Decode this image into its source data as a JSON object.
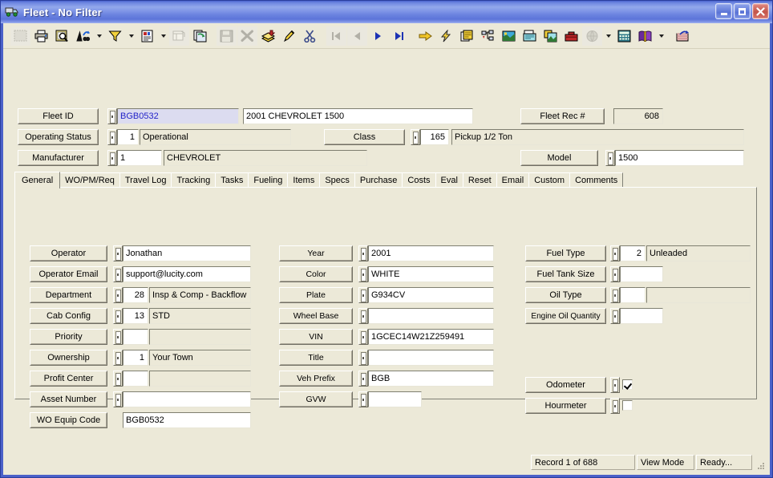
{
  "window": {
    "title": "Fleet - No Filter",
    "icon": "truck-icon",
    "minimize_label": "Minimize",
    "maximize_label": "Maximize",
    "close_label": "Close"
  },
  "toolbar": {
    "groups": [
      {
        "buttons": [
          {
            "name": "new-record-icon",
            "label": "New",
            "disabled": true
          },
          {
            "name": "print-icon",
            "label": "Print"
          },
          {
            "name": "print-preview-icon",
            "label": "Print Preview"
          },
          {
            "name": "find-icon",
            "label": "Find"
          },
          {
            "name": "dropdown-arrow",
            "label": "",
            "dropdown": true
          },
          {
            "name": "filter-icon",
            "label": "Filter"
          },
          {
            "name": "dropdown-arrow",
            "label": "",
            "dropdown": true
          },
          {
            "name": "report-icon",
            "label": "Report"
          },
          {
            "name": "dropdown-arrow",
            "label": "",
            "dropdown": true
          },
          {
            "name": "grid-view-icon",
            "label": "Grid View",
            "disabled": true
          },
          {
            "name": "copy-record-icon",
            "label": "Copy Record"
          }
        ]
      },
      {
        "buttons": [
          {
            "name": "save-icon",
            "label": "Save",
            "disabled": true
          },
          {
            "name": "delete-icon",
            "label": "Delete",
            "disabled": true
          },
          {
            "name": "add-record-icon",
            "label": "Add Record"
          },
          {
            "name": "edit-icon",
            "label": "Edit"
          },
          {
            "name": "cut-icon",
            "label": "Cut"
          }
        ]
      },
      {
        "buttons": [
          {
            "name": "first-record-icon",
            "label": "First Record",
            "disabled": true
          },
          {
            "name": "previous-record-icon",
            "label": "Previous Record",
            "disabled": true
          },
          {
            "name": "next-record-icon",
            "label": "Next Record"
          },
          {
            "name": "last-record-icon",
            "label": "Last Record"
          }
        ]
      },
      {
        "buttons": [
          {
            "name": "goto-icon",
            "label": "Go To"
          },
          {
            "name": "lightning-icon",
            "label": "Quick Action"
          },
          {
            "name": "documents-icon",
            "label": "Documents"
          },
          {
            "name": "tree-view-icon",
            "label": "Tree View"
          },
          {
            "name": "gis-map-icon",
            "label": "GIS Map"
          },
          {
            "name": "fax-icon",
            "label": "Fax"
          },
          {
            "name": "image-icon",
            "label": "Images"
          },
          {
            "name": "toolbox-icon",
            "label": "Toolbox"
          },
          {
            "name": "globe-icon",
            "label": "Web",
            "disabled": true
          },
          {
            "name": "dropdown-arrow",
            "label": "",
            "dropdown": true
          },
          {
            "name": "calculator-icon",
            "label": "Calculator"
          },
          {
            "name": "help-book-icon",
            "label": "Help"
          },
          {
            "name": "dropdown-arrow",
            "label": "",
            "dropdown": true
          }
        ]
      },
      {
        "buttons": [
          {
            "name": "exit-icon",
            "label": "Exit"
          }
        ]
      }
    ]
  },
  "header": {
    "fleet_id": {
      "label": "Fleet ID",
      "value": "BGB0532",
      "picker": true
    },
    "description": {
      "value": "2001 CHEVROLET 1500"
    },
    "fleet_rec": {
      "label": "Fleet Rec #",
      "value": "608"
    },
    "operating_status": {
      "label": "Operating Status",
      "code": "1",
      "value": "Operational",
      "picker": true
    },
    "class": {
      "label": "Class",
      "code": "165",
      "value": "Pickup 1/2 Ton",
      "picker": true
    },
    "manufacturer": {
      "label": "Manufacturer",
      "code": "1",
      "value": "CHEVROLET",
      "picker": true
    },
    "model": {
      "label": "Model",
      "value": "1500",
      "picker": true
    }
  },
  "tabs": [
    {
      "label": "General",
      "active": true
    },
    {
      "label": "WO/PM/Req",
      "active": false
    },
    {
      "label": "Travel Log",
      "active": false
    },
    {
      "label": "Tracking",
      "active": false
    },
    {
      "label": "Tasks",
      "active": false
    },
    {
      "label": "Fueling",
      "active": false
    },
    {
      "label": "Items",
      "active": false
    },
    {
      "label": "Specs",
      "active": false
    },
    {
      "label": "Purchase",
      "active": false
    },
    {
      "label": "Costs",
      "active": false
    },
    {
      "label": "Eval",
      "active": false
    },
    {
      "label": "Reset",
      "active": false
    },
    {
      "label": "Email",
      "active": false
    },
    {
      "label": "Custom",
      "active": false
    },
    {
      "label": "Comments",
      "active": false
    }
  ],
  "general": {
    "column_left": [
      {
        "label": "Operator",
        "picker": true,
        "code": null,
        "value": "Jonathan",
        "value_readonly": false,
        "wide": true
      },
      {
        "label": "Operator Email",
        "picker": true,
        "code": null,
        "value": "support@lucity.com",
        "value_readonly": false,
        "wide": true
      },
      {
        "label": "Department",
        "picker": true,
        "code": "28",
        "value": "Insp & Comp - Backflow",
        "value_readonly": true,
        "wide": false
      },
      {
        "label": "Cab Config",
        "picker": true,
        "code": "13",
        "value": "STD",
        "value_readonly": true,
        "wide": false
      },
      {
        "label": "Priority",
        "picker": true,
        "code": "",
        "value": "",
        "value_readonly": true,
        "wide": false
      },
      {
        "label": "Ownership",
        "picker": true,
        "code": "1",
        "value": "Your Town",
        "value_readonly": true,
        "wide": false
      },
      {
        "label": "Profit Center",
        "picker": true,
        "code": "",
        "value": "",
        "value_readonly": true,
        "wide": false
      },
      {
        "label": "Asset Number",
        "picker": true,
        "code": null,
        "value": "",
        "value_readonly": false,
        "wide": true
      },
      {
        "label": "WO Equip Code",
        "picker": false,
        "code": null,
        "value": "BGB0532",
        "value_readonly": false,
        "wide": true
      }
    ],
    "column_middle": [
      {
        "label": "Year",
        "picker": true,
        "value": "2001",
        "short": false
      },
      {
        "label": "Color",
        "picker": true,
        "value": "WHITE",
        "short": false
      },
      {
        "label": "Plate",
        "picker": true,
        "value": "G934CV",
        "short": false
      },
      {
        "label": "Wheel Base",
        "picker": true,
        "value": "",
        "short": false
      },
      {
        "label": "VIN",
        "picker": true,
        "value": "1GCEC14W21Z259491",
        "short": false
      },
      {
        "label": "Title",
        "picker": true,
        "value": "",
        "short": false
      },
      {
        "label": "Veh Prefix",
        "picker": true,
        "value": "BGB",
        "short": false
      },
      {
        "label": "GVW",
        "picker": true,
        "value": "",
        "short": true
      }
    ],
    "column_right": [
      {
        "label": "Fuel Type",
        "picker": true,
        "code": "2",
        "value": "Unleaded",
        "type": "coded"
      },
      {
        "label": "Fuel Tank Size",
        "picker": true,
        "code": "",
        "value": "",
        "type": "short"
      },
      {
        "label": "Oil Type",
        "picker": true,
        "code": "",
        "value": "",
        "type": "coded"
      },
      {
        "label": "Engine Oil Quantity",
        "picker": true,
        "code": "",
        "value": "",
        "type": "short"
      }
    ],
    "column_right_meters": [
      {
        "label": "Odometer",
        "picker": true,
        "checked": true
      },
      {
        "label": "Hourmeter",
        "picker": true,
        "checked": false
      }
    ]
  },
  "statusbar": {
    "record": "Record 1 of 688",
    "mode": "View Mode",
    "state": "Ready..."
  },
  "colors": {
    "titlebar": "#6b83e0",
    "face": "#ece9d8",
    "selected_field_bg": "#dcdcf0",
    "selected_field_fg": "#2323c8",
    "close_button": "#c4554a"
  }
}
